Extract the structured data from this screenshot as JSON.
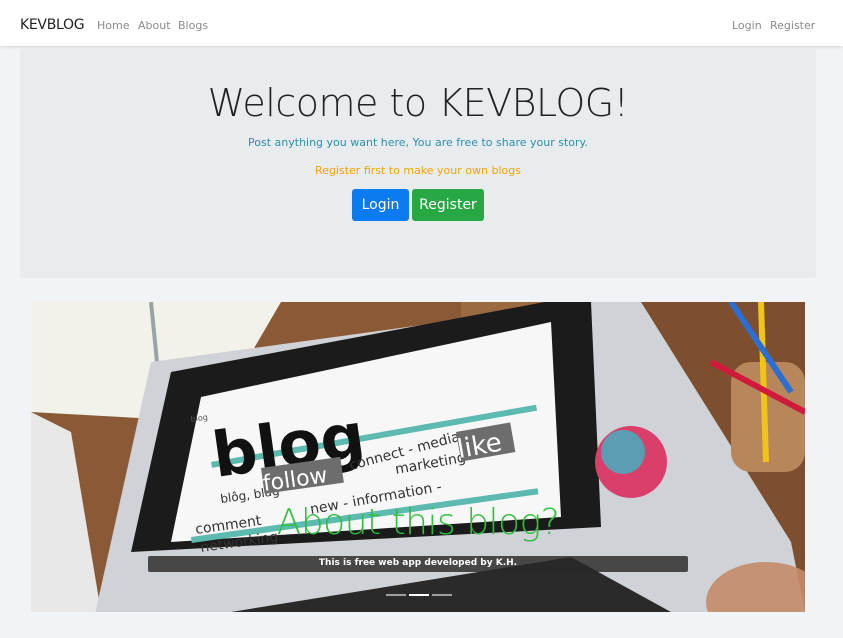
{
  "navbar": {
    "brand": "KEVBLOG",
    "left_links": [
      "Home",
      "About",
      "Blogs"
    ],
    "right_links": [
      "Login",
      "Register"
    ]
  },
  "jumbotron": {
    "title": "Welcome to KEVBLOG!",
    "lead": "Post anything you want here, You are free to share your story.",
    "note": "Register first to make your own blogs",
    "login_button": "Login",
    "register_button": "Register"
  },
  "carousel": {
    "caption_title": "About this blog?",
    "caption_text": "This is free web app developed by K.H.",
    "image_words": {
      "main": "blog",
      "pron": "blôg, bläg",
      "follow": "follow",
      "connect": "connect - media",
      "marketing": "marketing",
      "like": "like",
      "comment": "comment",
      "information": "new - information -",
      "networking": "networking",
      "search": "blog"
    },
    "indicator_count": 3,
    "active_index": 1
  },
  "colors": {
    "login_button": "#0d7bf0",
    "register_button": "#28a745",
    "lead_text": "#2f8fa8",
    "note_text": "#f0a400",
    "caption_title": "#2fbf3b"
  }
}
